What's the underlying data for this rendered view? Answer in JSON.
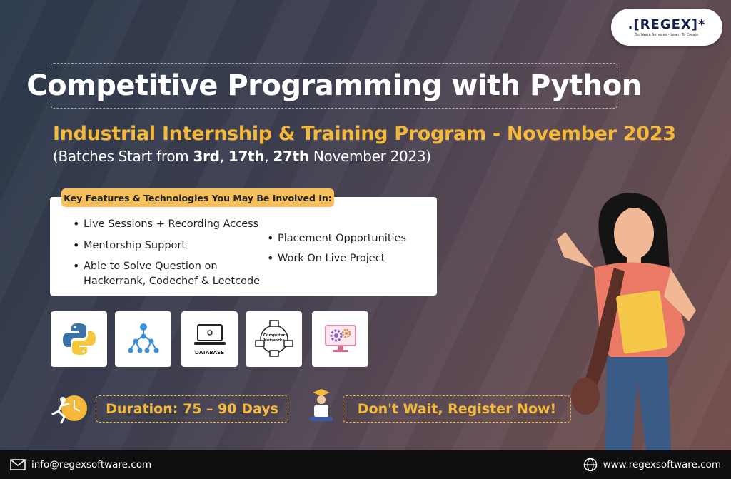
{
  "logo": {
    "word": "REGEX",
    "tagline": "Software Services - Learn To Create"
  },
  "title": "Competitive Programming with Python",
  "subtitle": "Industrial Internship & Training Program - November 2023",
  "batches": {
    "prefix": "(Batches Start from ",
    "d1": "3rd",
    "sep1": ", ",
    "d2": "17th",
    "sep2": ", ",
    "d3": "27th",
    "suffix": " November 2023)"
  },
  "features": {
    "heading": "Key Features & Technologies You May Be Involved In:",
    "left": [
      "Live Sessions + Recording Access",
      "Mentorship  Support",
      "Able to Solve Question on",
      "Hackerrank, Codechef & Leetcode"
    ],
    "right": [
      "Placement Opportunities",
      "Work On Live Project"
    ]
  },
  "tiles": {
    "database_label": "DATABASE",
    "network_label_1": "Computer",
    "network_label_2": "Networks"
  },
  "duration": "Duration: 75 – 90 Days",
  "register": "Don't Wait, Register Now!",
  "footer": {
    "email": "info@regexsoftware.com",
    "website": "www.regexsoftware.com"
  },
  "colors": {
    "accent": "#f4b83a",
    "heading_bg": "#f5bf5c",
    "footer_bg": "#0f0f10"
  }
}
